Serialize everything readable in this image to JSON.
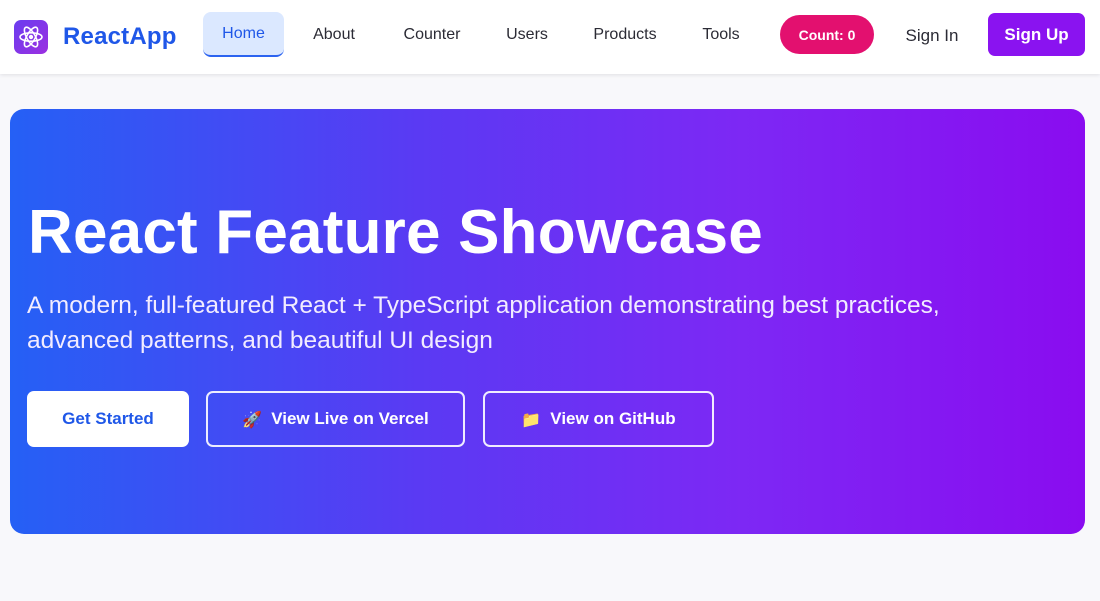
{
  "navbar": {
    "brand": {
      "logo_icon": "atom-icon",
      "name": "ReactApp"
    },
    "links": [
      {
        "label": "Home",
        "active": true
      },
      {
        "label": "About",
        "active": false
      },
      {
        "label": "Counter",
        "active": false
      },
      {
        "label": "Users",
        "active": false
      },
      {
        "label": "Products",
        "active": false
      },
      {
        "label": "Tools",
        "active": false
      }
    ],
    "count_badge": "Count: 0",
    "signin_label": "Sign In",
    "signup_label": "Sign Up"
  },
  "hero": {
    "title": "React Feature Showcase",
    "subtitle": "A modern, full-featured React + TypeScript application demonstrating best practices, advanced patterns, and beautiful UI design",
    "buttons": {
      "get_started": "Get Started",
      "vercel": {
        "icon": "🚀",
        "label": "View Live on Vercel"
      },
      "github": {
        "icon": "📁",
        "label": "View on GitHub"
      }
    }
  },
  "colors": {
    "brand_blue": "#1f57e8",
    "active_tab_bg": "#dbe8ff",
    "count_badge": "#e3106f",
    "signup": "#8a13f0",
    "hero_gradient_start": "#2560f5",
    "hero_gradient_end": "#8a0cf0",
    "page_bg": "#f8f8fb"
  }
}
